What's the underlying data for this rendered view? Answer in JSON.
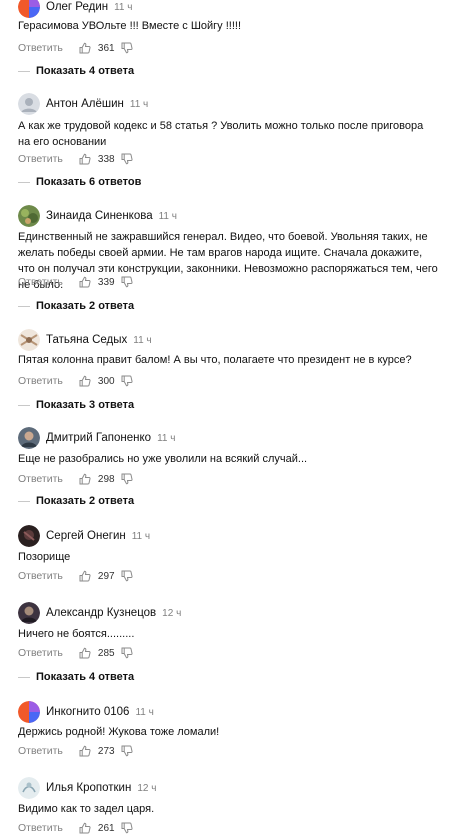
{
  "ui": {
    "reply_label": "Ответить"
  },
  "comments": [
    {
      "author": "Олег Редин",
      "time": "11 ч",
      "text": "Герасимова УВОльте !!! Вместе с Шойгу !!!!!",
      "likes": "361",
      "show_replies": "Показать 4 ответа",
      "avatar_icon": "avatar-colorful-icon"
    },
    {
      "author": "Антон Алёшин",
      "time": "11 ч",
      "text": "А как же трудовой кодекс и 58 статья ? Уволить можно только после приговора на его основании",
      "likes": "338",
      "show_replies": "Показать 6 ответов",
      "avatar_icon": "avatar-placeholder-icon"
    },
    {
      "author": "Зинаида Синенкова",
      "time": "11 ч",
      "text": "Единственный не зажравшийся генерал. Видео, что боевой. Увольняя таких, не желать победы своей армии. Не там врагов народа ищите. Сначала докажите, что он получал эти конструкции, законники. Невозможно распоряжаться тем, чего не было.",
      "likes": "339",
      "show_replies": "Показать 2 ответа",
      "avatar_icon": "avatar-nature-icon"
    },
    {
      "author": "Татьяна Седых",
      "time": "11 ч",
      "text": "Пятая колонна правит балом! А вы что, полагаете что президент не в курсе?",
      "likes": "300",
      "show_replies": "Показать 3 ответа",
      "avatar_icon": "avatar-pattern-icon"
    },
    {
      "author": "Дмитрий Гапоненко",
      "time": "11 ч",
      "text": "Еще не разобрались но уже уволили на всякий случай...",
      "likes": "298",
      "show_replies": "Показать 2 ответа",
      "avatar_icon": "avatar-photo-icon"
    },
    {
      "author": "Сергей Онегин",
      "time": "11 ч",
      "text": "Позорище",
      "likes": "297",
      "show_replies": "",
      "avatar_icon": "avatar-dark-icon"
    },
    {
      "author": "Александр Кузнецов",
      "time": "12 ч",
      "text": "Ничего не боятся.........",
      "likes": "285",
      "show_replies": "Показать 4 ответа",
      "avatar_icon": "avatar-photo-icon"
    },
    {
      "author": "Инкогнито 0106",
      "time": "11 ч",
      "text": "Держись родной! Жукова тоже ломали!",
      "likes": "273",
      "show_replies": "",
      "avatar_icon": "avatar-colorful-icon"
    },
    {
      "author": "Илья Кропоткин",
      "time": "12 ч",
      "text": "Видимо как то задел царя.",
      "likes": "261",
      "show_replies": "",
      "avatar_icon": "avatar-light-icon"
    }
  ]
}
